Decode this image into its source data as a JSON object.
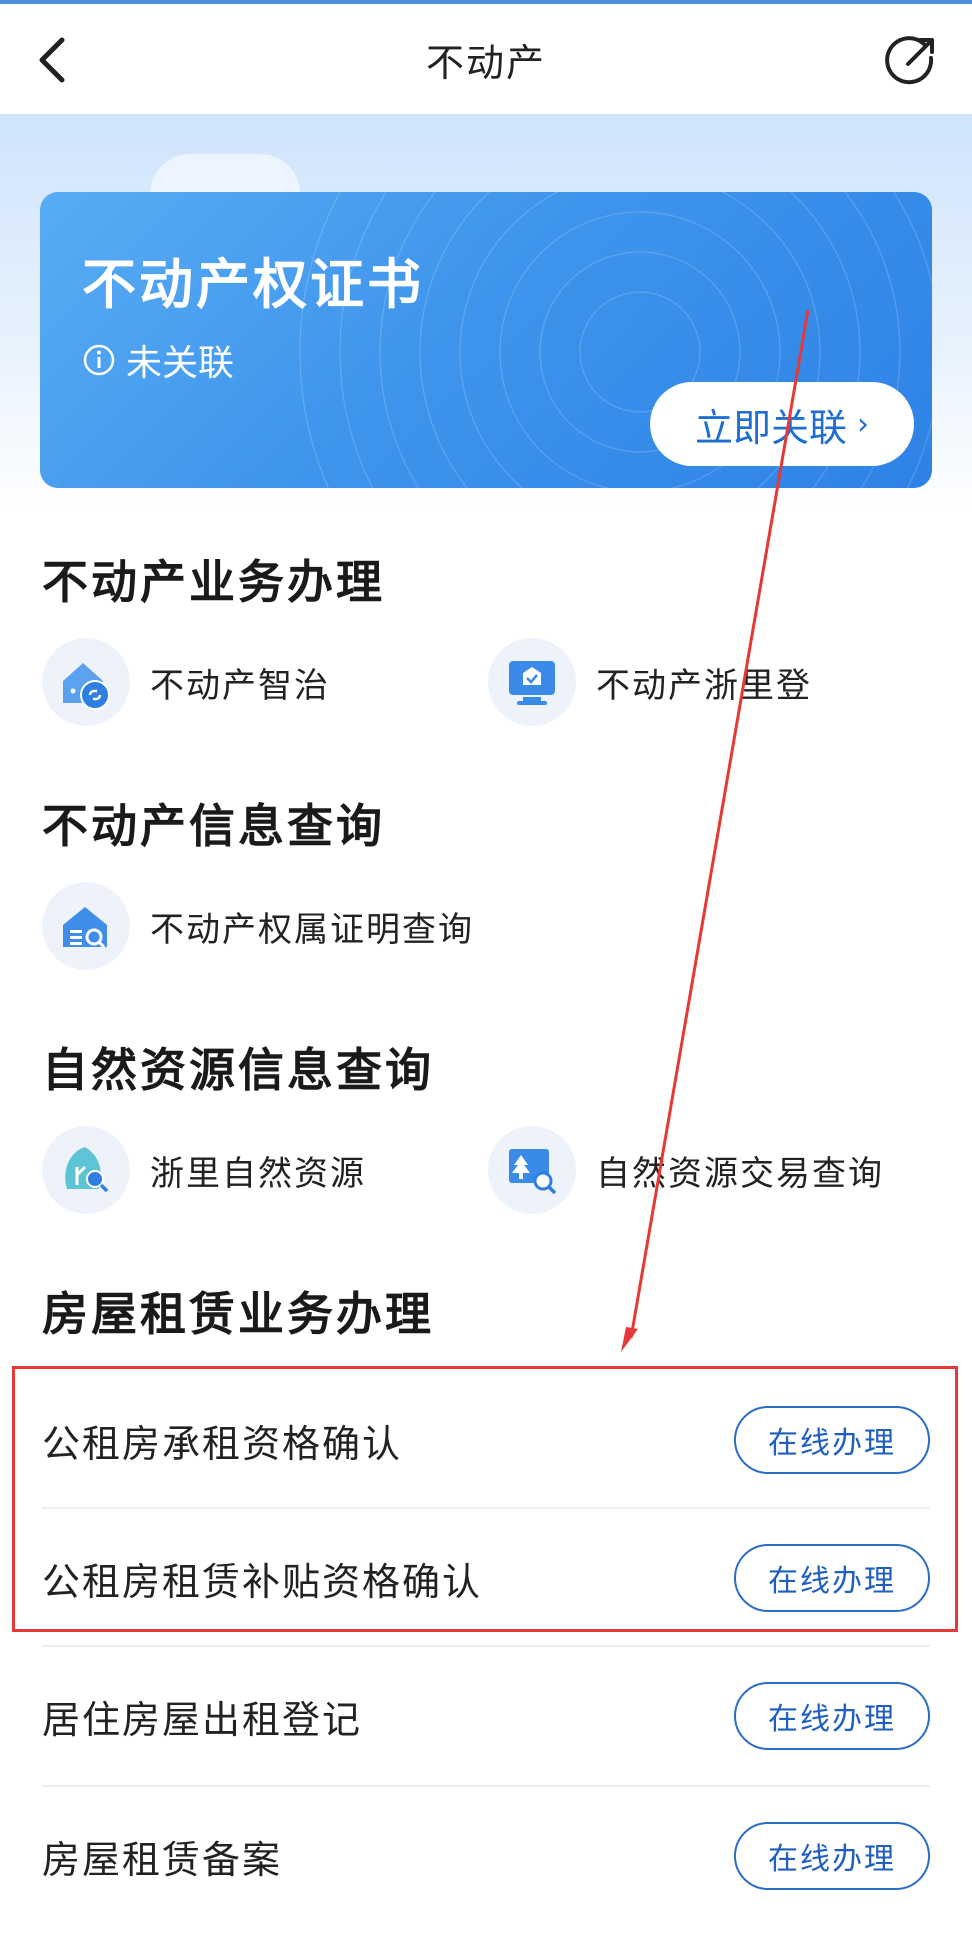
{
  "nav": {
    "title": "不动产",
    "back_icon": "chevron-left-icon",
    "share_icon": "share-icon"
  },
  "card": {
    "title": "不动产权证书",
    "status_icon": "info-icon",
    "status": "未关联",
    "action_label": "立即关联",
    "action_chevron": "›"
  },
  "sections": {
    "business": {
      "title": "不动产业务办理",
      "items": [
        {
          "label": "不动产智治",
          "icon": "house-link-icon"
        },
        {
          "label": "不动产浙里登",
          "icon": "monitor-check-icon"
        }
      ]
    },
    "info_query": {
      "title": "不动产信息查询",
      "items": [
        {
          "label": "不动产权属证明查询",
          "icon": "house-search-icon"
        }
      ]
    },
    "natural": {
      "title": "自然资源信息查询",
      "items": [
        {
          "label": "浙里自然资源",
          "icon": "leaf-search-icon"
        },
        {
          "label": "自然资源交易查询",
          "icon": "tree-search-icon"
        }
      ]
    },
    "rental": {
      "title": "房屋租赁业务办理",
      "rows": [
        {
          "label": "公租房承租资格确认",
          "action": "在线办理"
        },
        {
          "label": "公租房租赁补贴资格确认",
          "action": "在线办理"
        },
        {
          "label": "居住房屋出租登记",
          "action": "在线办理"
        },
        {
          "label": "房屋租赁备案",
          "action": "在线办理"
        }
      ]
    }
  },
  "colors": {
    "accent": "#2e82e6",
    "button_text": "#1f5fbf",
    "annotation_red": "#e53935"
  }
}
